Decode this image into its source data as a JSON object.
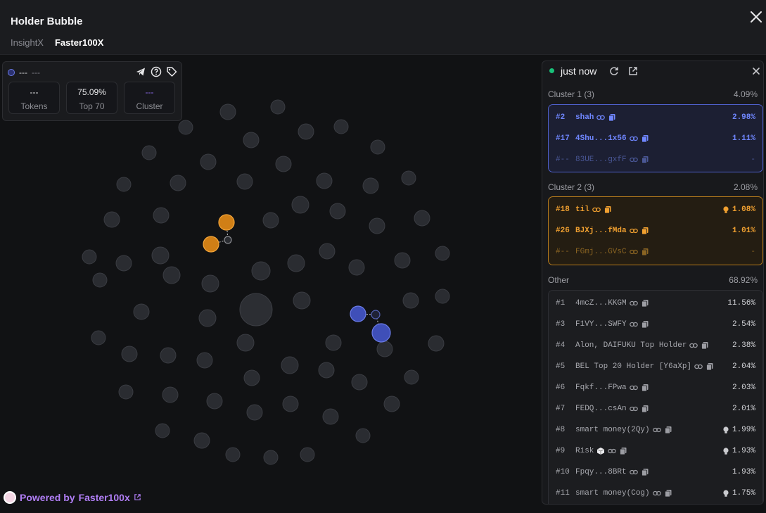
{
  "header": {
    "title": "Holder Bubble",
    "tabs": [
      {
        "label": "InsightX",
        "active": false
      },
      {
        "label": "Faster100X",
        "active": true
      }
    ]
  },
  "stats": {
    "name": "---",
    "sub": "---",
    "boxes": [
      {
        "value": "---",
        "label": "Tokens"
      },
      {
        "value": "75.09%",
        "label": "Top 70"
      },
      {
        "value": "---",
        "label": "Cluster"
      }
    ]
  },
  "powered": {
    "prefix": "Powered by",
    "brand": "Faster100x"
  },
  "panel": {
    "status": "just now",
    "clusters": [
      {
        "name": "Cluster 1 (3)",
        "pct": "4.09%",
        "color": "blue",
        "rows": [
          {
            "rank": "#2",
            "name": "shah",
            "pct": "2.98%",
            "dim": false,
            "bulb": false
          },
          {
            "rank": "#17",
            "name": "4Shu...1x56",
            "pct": "1.11%",
            "dim": false,
            "bulb": false
          },
          {
            "rank": "#--",
            "name": "83UE...gxfF",
            "pct": "-",
            "dim": true,
            "bulb": false
          }
        ]
      },
      {
        "name": "Cluster 2 (3)",
        "pct": "2.08%",
        "color": "orange",
        "rows": [
          {
            "rank": "#18",
            "name": "til",
            "pct": "1.08%",
            "dim": false,
            "bulb": true
          },
          {
            "rank": "#26",
            "name": "BJXj...fMda",
            "pct": "1.01%",
            "dim": false,
            "bulb": false
          },
          {
            "rank": "#--",
            "name": "FGmj...GVsC",
            "pct": "-",
            "dim": true,
            "bulb": false
          }
        ]
      }
    ],
    "other": {
      "name": "Other",
      "pct": "68.92%",
      "rows": [
        {
          "rank": "#1",
          "name": "4mcZ...KKGM",
          "pct": "11.56%",
          "bulb": false,
          "cube": false
        },
        {
          "rank": "#3",
          "name": "F1VY...SWFY",
          "pct": "2.54%",
          "bulb": false,
          "cube": false
        },
        {
          "rank": "#4",
          "name": "Alon, DAIFUKU Top Holder",
          "pct": "2.38%",
          "bulb": false,
          "cube": false
        },
        {
          "rank": "#5",
          "name": "BEL Top 20 Holder [Y6aXp]",
          "pct": "2.04%",
          "bulb": false,
          "cube": false
        },
        {
          "rank": "#6",
          "name": "Fqkf...FPwa",
          "pct": "2.03%",
          "bulb": false,
          "cube": false
        },
        {
          "rank": "#7",
          "name": "FEDQ...csAn",
          "pct": "2.01%",
          "bulb": false,
          "cube": false
        },
        {
          "rank": "#8",
          "name": "smart money(2Qy)",
          "pct": "1.99%",
          "bulb": true,
          "cube": false
        },
        {
          "rank": "#9",
          "name": "Risk",
          "pct": "1.93%",
          "bulb": true,
          "cube": true
        },
        {
          "rank": "#10",
          "name": "Fpqy...8BRt",
          "pct": "1.93%",
          "bulb": false,
          "cube": false
        },
        {
          "rank": "#11",
          "name": "smart money(Cog)",
          "pct": "1.75%",
          "bulb": true,
          "cube": false
        }
      ]
    }
  },
  "colors": {
    "bubble": "#2a2c31",
    "bubble_border": "#3a3c42",
    "cluster1": "#3f4fb8",
    "cluster2": "#d07f16",
    "accent_purple": "#b07ef5"
  }
}
